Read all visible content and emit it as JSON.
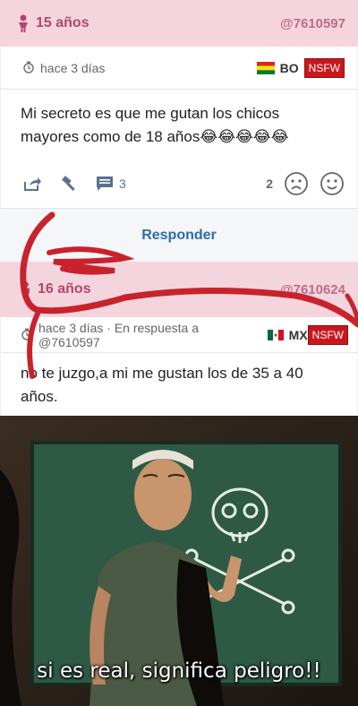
{
  "post": {
    "age": "15 años",
    "user_id": "@7610597",
    "time": "hace 3 días",
    "country": "BO",
    "nsfw": "NSFW",
    "text": "Mi secreto es que me gutan los chicos mayores como de 18 años😂😂😂😂😂",
    "comments": "3",
    "votes": "2"
  },
  "reply_button": "Responder",
  "reply": {
    "age": "16 años",
    "user_id": "@7610624",
    "meta": "hace 3 días · En respuesta a @7610597",
    "country": "MX",
    "nsfw": "NSFW",
    "text": "no te juzgo,a mi me gustan los de 35 a 40 años."
  },
  "meme": {
    "caption": "si es real, significa peligro!!"
  },
  "colors": {
    "header_bg": "#f4d5de",
    "accent": "#b4456f",
    "link": "#2b6cb0",
    "scribble": "#c8232c"
  }
}
